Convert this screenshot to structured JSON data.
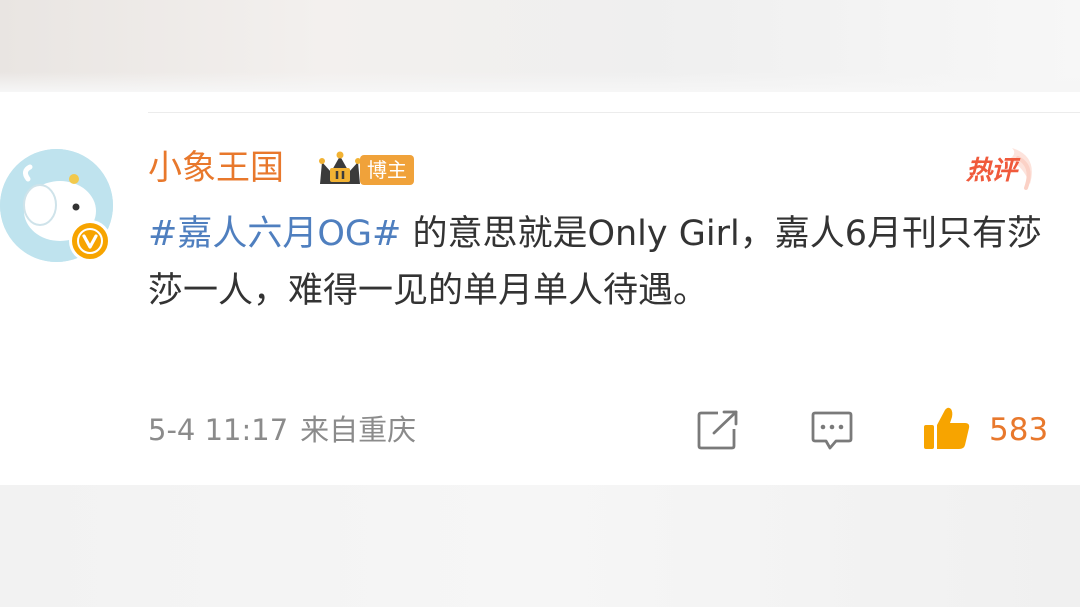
{
  "post": {
    "author": "小象王国",
    "role_badge": "博主",
    "hot_label": "热评",
    "hashtag": "#嘉人六月OG#",
    "text": " 的意思就是Only Girl，嘉人6月刊只有莎莎一人，难得一见的单月单人待遇。",
    "date": "5-4 11:17",
    "source": "来自重庆",
    "like_count": "583"
  },
  "icons": {
    "crown": "crown-badge-icon",
    "verified": "verified-v-icon",
    "share": "share-icon",
    "comment": "comment-icon",
    "like": "thumbs-up-icon"
  },
  "colors": {
    "username": "#e8782c",
    "hashtag": "#4f7fbf",
    "meta": "#8b8b8b",
    "hot": "#f05a3c",
    "like": "#f7a400"
  }
}
